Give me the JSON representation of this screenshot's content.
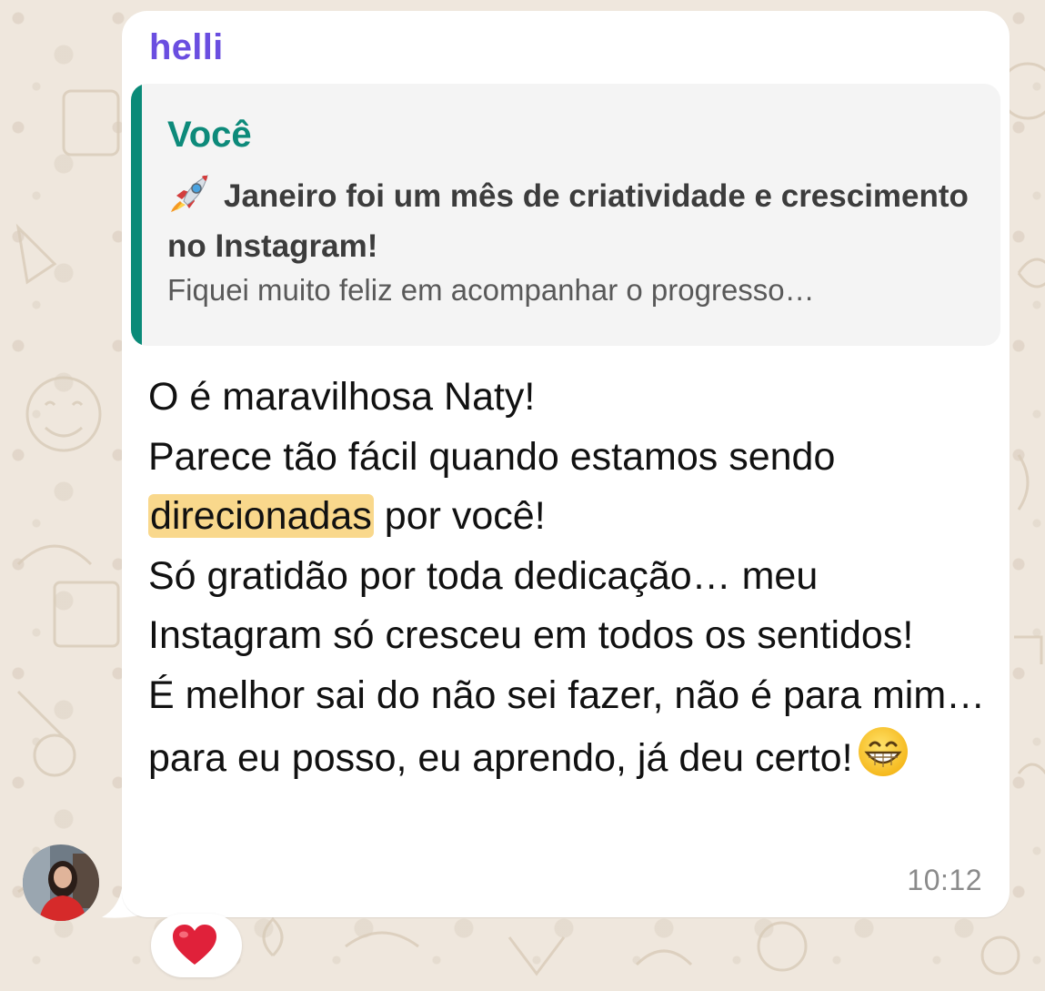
{
  "chat": {
    "sender_name": "helli",
    "quoted": {
      "author": "Você",
      "title": "Janeiro foi um mês de criatividade e crescimento no Instagram!",
      "title_icon": "rocket-emoji",
      "preview": "Fiquei muito feliz em acompanhar o progresso…"
    },
    "message": {
      "line1": "O é maravilhosa Naty!",
      "line2": "Parece tão fácil quando estamos sendo",
      "highlighted_word": "direcionadas",
      "line3_rest": " por você!",
      "line4": "Só gratidão por toda dedicação… meu Instagram só cresceu em todos os sentidos!",
      "line5": "É melhor sai do não sei fazer, não é para mim… para eu posso, eu aprendo, já deu certo!",
      "end_emoji": "grinning-face-emoji"
    },
    "time": "10:12",
    "reaction": "heart-emoji",
    "colors": {
      "sender": "#6a4ee0",
      "quote_author": "#0d8a7a",
      "quote_bar": "#0a8a78",
      "highlight": "#f9d88c",
      "heart": "#e0213a"
    }
  }
}
